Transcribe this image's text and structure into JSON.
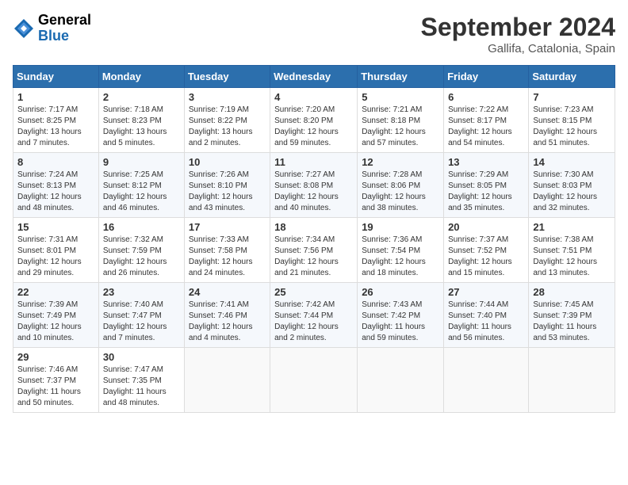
{
  "header": {
    "logo_general": "General",
    "logo_blue": "Blue",
    "month_title": "September 2024",
    "location": "Gallifa, Catalonia, Spain"
  },
  "days_of_week": [
    "Sunday",
    "Monday",
    "Tuesday",
    "Wednesday",
    "Thursday",
    "Friday",
    "Saturday"
  ],
  "weeks": [
    [
      {
        "day": 1,
        "sunrise": "7:17 AM",
        "sunset": "8:25 PM",
        "daylight": "13 hours and 7 minutes."
      },
      {
        "day": 2,
        "sunrise": "7:18 AM",
        "sunset": "8:23 PM",
        "daylight": "13 hours and 5 minutes."
      },
      {
        "day": 3,
        "sunrise": "7:19 AM",
        "sunset": "8:22 PM",
        "daylight": "13 hours and 2 minutes."
      },
      {
        "day": 4,
        "sunrise": "7:20 AM",
        "sunset": "8:20 PM",
        "daylight": "12 hours and 59 minutes."
      },
      {
        "day": 5,
        "sunrise": "7:21 AM",
        "sunset": "8:18 PM",
        "daylight": "12 hours and 57 minutes."
      },
      {
        "day": 6,
        "sunrise": "7:22 AM",
        "sunset": "8:17 PM",
        "daylight": "12 hours and 54 minutes."
      },
      {
        "day": 7,
        "sunrise": "7:23 AM",
        "sunset": "8:15 PM",
        "daylight": "12 hours and 51 minutes."
      }
    ],
    [
      {
        "day": 8,
        "sunrise": "7:24 AM",
        "sunset": "8:13 PM",
        "daylight": "12 hours and 48 minutes."
      },
      {
        "day": 9,
        "sunrise": "7:25 AM",
        "sunset": "8:12 PM",
        "daylight": "12 hours and 46 minutes."
      },
      {
        "day": 10,
        "sunrise": "7:26 AM",
        "sunset": "8:10 PM",
        "daylight": "12 hours and 43 minutes."
      },
      {
        "day": 11,
        "sunrise": "7:27 AM",
        "sunset": "8:08 PM",
        "daylight": "12 hours and 40 minutes."
      },
      {
        "day": 12,
        "sunrise": "7:28 AM",
        "sunset": "8:06 PM",
        "daylight": "12 hours and 38 minutes."
      },
      {
        "day": 13,
        "sunrise": "7:29 AM",
        "sunset": "8:05 PM",
        "daylight": "12 hours and 35 minutes."
      },
      {
        "day": 14,
        "sunrise": "7:30 AM",
        "sunset": "8:03 PM",
        "daylight": "12 hours and 32 minutes."
      }
    ],
    [
      {
        "day": 15,
        "sunrise": "7:31 AM",
        "sunset": "8:01 PM",
        "daylight": "12 hours and 29 minutes."
      },
      {
        "day": 16,
        "sunrise": "7:32 AM",
        "sunset": "7:59 PM",
        "daylight": "12 hours and 26 minutes."
      },
      {
        "day": 17,
        "sunrise": "7:33 AM",
        "sunset": "7:58 PM",
        "daylight": "12 hours and 24 minutes."
      },
      {
        "day": 18,
        "sunrise": "7:34 AM",
        "sunset": "7:56 PM",
        "daylight": "12 hours and 21 minutes."
      },
      {
        "day": 19,
        "sunrise": "7:36 AM",
        "sunset": "7:54 PM",
        "daylight": "12 hours and 18 minutes."
      },
      {
        "day": 20,
        "sunrise": "7:37 AM",
        "sunset": "7:52 PM",
        "daylight": "12 hours and 15 minutes."
      },
      {
        "day": 21,
        "sunrise": "7:38 AM",
        "sunset": "7:51 PM",
        "daylight": "12 hours and 13 minutes."
      }
    ],
    [
      {
        "day": 22,
        "sunrise": "7:39 AM",
        "sunset": "7:49 PM",
        "daylight": "12 hours and 10 minutes."
      },
      {
        "day": 23,
        "sunrise": "7:40 AM",
        "sunset": "7:47 PM",
        "daylight": "12 hours and 7 minutes."
      },
      {
        "day": 24,
        "sunrise": "7:41 AM",
        "sunset": "7:46 PM",
        "daylight": "12 hours and 4 minutes."
      },
      {
        "day": 25,
        "sunrise": "7:42 AM",
        "sunset": "7:44 PM",
        "daylight": "12 hours and 2 minutes."
      },
      {
        "day": 26,
        "sunrise": "7:43 AM",
        "sunset": "7:42 PM",
        "daylight": "11 hours and 59 minutes."
      },
      {
        "day": 27,
        "sunrise": "7:44 AM",
        "sunset": "7:40 PM",
        "daylight": "11 hours and 56 minutes."
      },
      {
        "day": 28,
        "sunrise": "7:45 AM",
        "sunset": "7:39 PM",
        "daylight": "11 hours and 53 minutes."
      }
    ],
    [
      {
        "day": 29,
        "sunrise": "7:46 AM",
        "sunset": "7:37 PM",
        "daylight": "11 hours and 50 minutes."
      },
      {
        "day": 30,
        "sunrise": "7:47 AM",
        "sunset": "7:35 PM",
        "daylight": "11 hours and 48 minutes."
      },
      null,
      null,
      null,
      null,
      null
    ]
  ]
}
